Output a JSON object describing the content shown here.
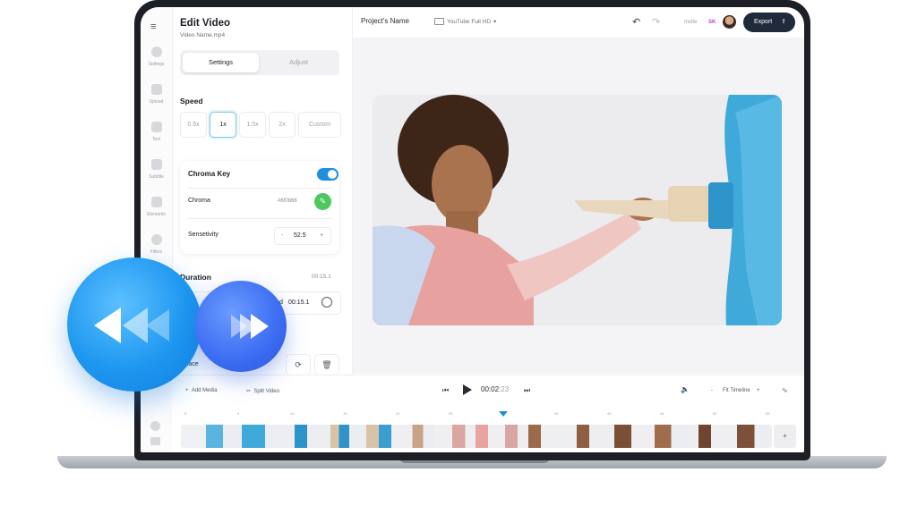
{
  "rail": {
    "items": [
      {
        "label": "Settings",
        "icon": "gear-icon"
      },
      {
        "label": "Upload",
        "icon": "image-icon"
      },
      {
        "label": "Text",
        "icon": "text-icon"
      },
      {
        "label": "Subtitle",
        "icon": "subtitle-icon"
      },
      {
        "label": "Elements",
        "icon": "shapes-icon"
      },
      {
        "label": "Filters",
        "icon": "filter-icon"
      }
    ]
  },
  "panel": {
    "title": "Edit Video",
    "subtitle": "Video Name.mp4",
    "tabs": [
      "Settings",
      "Adjust"
    ],
    "speed": {
      "label": "Speed",
      "options": [
        "0.5x",
        "1x",
        "1.5x",
        "2x",
        "Custom"
      ],
      "selected": "1x"
    },
    "chroma": {
      "title": "Chroma Key",
      "enabled": true,
      "chroma_label": "Chroma",
      "chroma_value": "#6f0b66",
      "sensitivity_label": "Sensetivity",
      "sensitivity_value": "52.5",
      "minus": "-",
      "plus": "+"
    },
    "duration": {
      "label": "Duration",
      "total": "00:15.1",
      "end_prefix": "d",
      "end_value": "00:15.1"
    },
    "replace_label": "eplace"
  },
  "topbar": {
    "project_name": "Project's Name",
    "format": "YouTube Full HD",
    "invite": "Invite",
    "initials": "SK",
    "export": "Export"
  },
  "timeline": {
    "add_media": "Add Media",
    "split_video": "Split Video",
    "time_current": "00:02",
    "time_frames": ":23",
    "fit": "Fit Timeline",
    "minus": "-",
    "plus": "+",
    "ticks": [
      "0",
      "5",
      "10",
      "15",
      "20",
      "25",
      "30",
      "35",
      "40",
      "45",
      "50",
      "55"
    ],
    "add_clip": "+"
  },
  "colors": {
    "accent": "#1e8fe0",
    "export_bg": "#1f2a3a",
    "toggle_on": "#1e8fe0",
    "eyedropper": "#4cc85e",
    "rewind": "#1e97f0",
    "forward": "#3c6cf2"
  }
}
